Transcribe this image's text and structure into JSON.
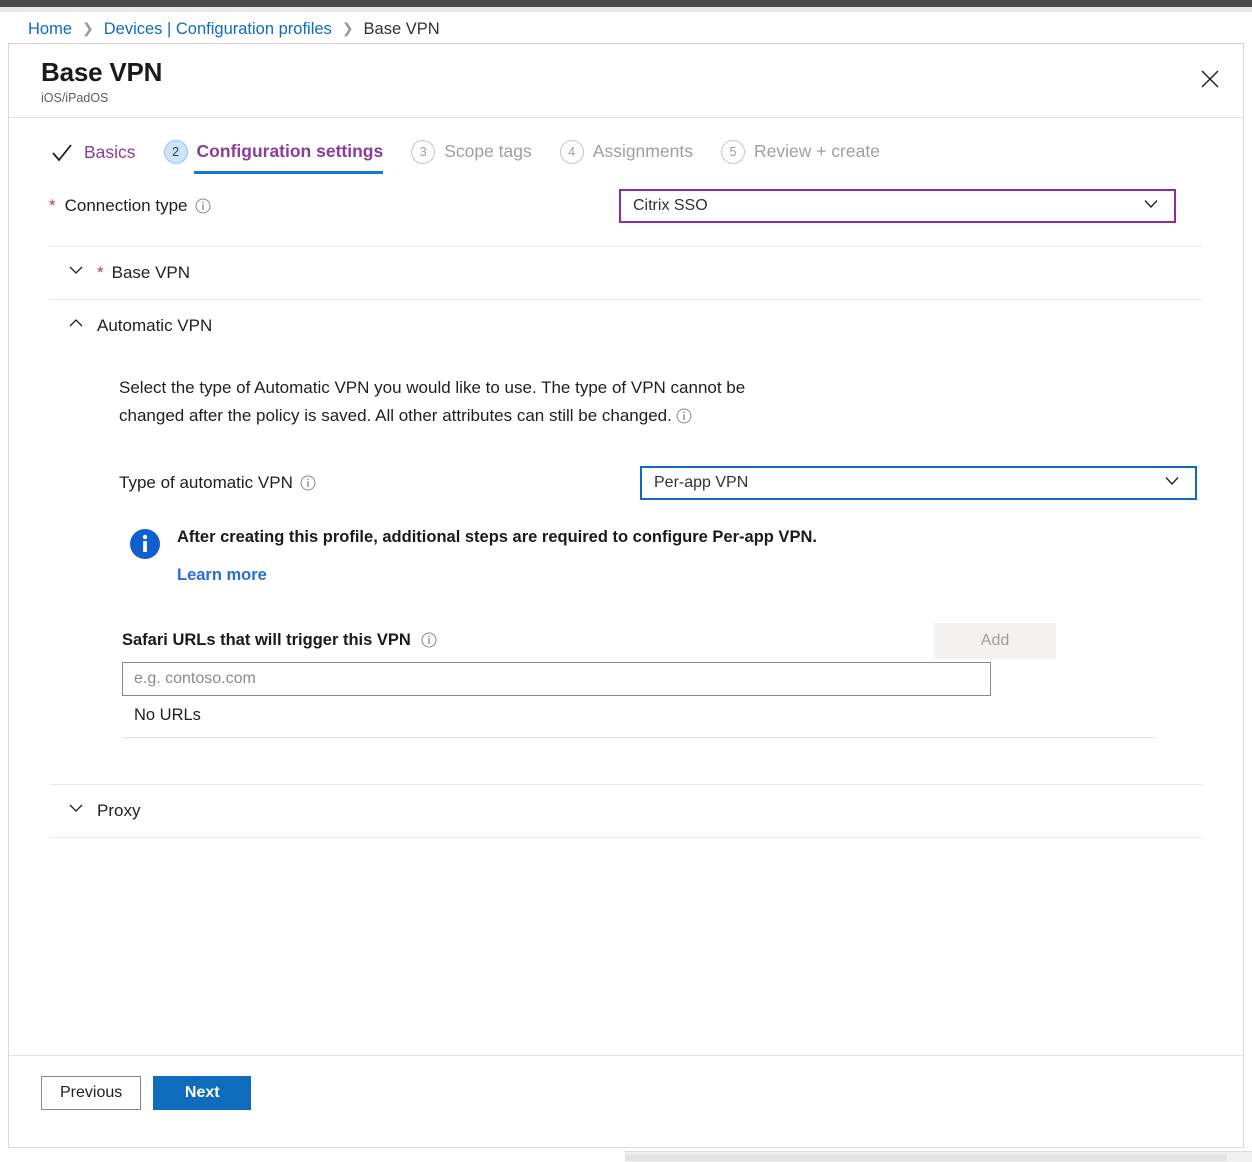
{
  "breadcrumb": {
    "items": [
      {
        "label": "Home",
        "link": true
      },
      {
        "label": "Devices | Configuration profiles",
        "link": true
      },
      {
        "label": "Base VPN",
        "link": false
      }
    ],
    "separator": "❯"
  },
  "blade": {
    "title": "Base VPN",
    "subtitle": "iOS/iPadOS",
    "close_icon": "close-icon"
  },
  "wizard": {
    "steps": [
      {
        "badge": "✓",
        "label": "Basics",
        "state": "done"
      },
      {
        "badge": "2",
        "label": "Configuration settings",
        "state": "active"
      },
      {
        "badge": "3",
        "label": "Scope tags",
        "state": "todo"
      },
      {
        "badge": "4",
        "label": "Assignments",
        "state": "todo"
      },
      {
        "badge": "5",
        "label": "Review + create",
        "state": "todo"
      }
    ]
  },
  "form": {
    "connection_type": {
      "label": "Connection type",
      "required_marker": "*",
      "value": "Citrix SSO",
      "info_icon": "info-icon",
      "chevron_icon": "chevron-down-icon",
      "border_color": "#8b2d9e"
    },
    "sections": {
      "base_vpn": {
        "label": "Base VPN",
        "required_marker": "*",
        "expanded": false,
        "chevron_icon": "chevron-down-icon"
      },
      "automatic_vpn": {
        "label": "Automatic VPN",
        "expanded": true,
        "chevron_icon": "chevron-up-icon",
        "description": "Select the type of Automatic VPN you would like to use. The type of VPN cannot be changed after the policy is saved. All other attributes can still be changed.",
        "type_field": {
          "label": "Type of automatic VPN",
          "value": "Per-app VPN",
          "info_icon": "info-icon",
          "chevron_icon": "chevron-down-icon",
          "border_color": "#0f6cbd"
        },
        "info_banner": {
          "icon": "info-filled-icon",
          "message": "After creating this profile, additional steps are required to configure Per-app VPN.",
          "link_label": "Learn more",
          "link_color": "#2a6fd6"
        },
        "safari_urls": {
          "label": "Safari URLs that will trigger this VPN",
          "info_icon": "info-icon",
          "add_button": "Add",
          "add_button_disabled": true,
          "input_value": "",
          "input_placeholder": "e.g. contoso.com",
          "empty_text": "No URLs"
        }
      },
      "proxy": {
        "label": "Proxy",
        "expanded": false,
        "chevron_icon": "chevron-down-icon"
      }
    }
  },
  "footer": {
    "previous_label": "Previous",
    "next_label": "Next",
    "next_color": "#0f6cbd"
  }
}
